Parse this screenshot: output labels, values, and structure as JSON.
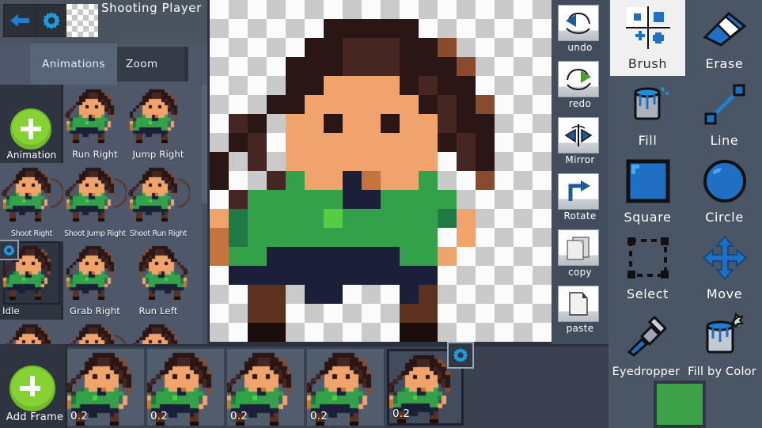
{
  "app": {
    "project_title": "Shooting Player",
    "accent_green": "#86d234",
    "selected_color": "#3da14a",
    "panel_bg": "#4a5565",
    "left_panel_bg": "#4e586a",
    "timeline_bg": "#3a4150"
  },
  "header": {
    "back_icon": "back-arrow-icon",
    "settings_icon": "gear-icon",
    "transparency_swatch": "transparency-checker-swatch"
  },
  "tabs": [
    {
      "id": "animations",
      "label": "Animations",
      "active": true
    },
    {
      "id": "zoom",
      "label": "Zoom",
      "active": false
    }
  ],
  "animations_panel": {
    "add_button_label": "Animation",
    "add_button_icon": "plus-icon",
    "selected_gear_icon": "gear-icon",
    "items": [
      {
        "label": "Run Right",
        "selected": false
      },
      {
        "label": "Jump Right",
        "selected": false
      },
      {
        "label": "Shoot Right",
        "selected": false
      },
      {
        "label": "Shoot Jump Right",
        "selected": false
      },
      {
        "label": "Shoot Run Right",
        "selected": false
      },
      {
        "label": "Idle",
        "selected": true
      },
      {
        "label": "Grab Right",
        "selected": false
      },
      {
        "label": "Run Left",
        "selected": false
      }
    ]
  },
  "edit_tools": [
    {
      "id": "undo",
      "label": "undo",
      "icon": "undo-arrow-icon"
    },
    {
      "id": "redo",
      "label": "redo",
      "icon": "redo-arrow-icon"
    },
    {
      "id": "mirror",
      "label": "Mirror",
      "icon": "mirror-icon"
    },
    {
      "id": "rotate",
      "label": "Rotate",
      "icon": "rotate-arrow-icon"
    },
    {
      "id": "copy",
      "label": "copy",
      "icon": "copy-pages-icon"
    },
    {
      "id": "paste",
      "label": "paste",
      "icon": "paste-page-icon"
    }
  ],
  "paint_tools": [
    {
      "id": "brush",
      "label": "Brush",
      "icon": "brush-quad-icon",
      "selected": true
    },
    {
      "id": "erase",
      "label": "Erase",
      "icon": "eraser-icon",
      "selected": false
    },
    {
      "id": "fill",
      "label": "Fill",
      "icon": "paint-bucket-icon",
      "selected": false
    },
    {
      "id": "line",
      "label": "Line",
      "icon": "line-icon",
      "selected": false
    },
    {
      "id": "square",
      "label": "Square",
      "icon": "square-icon",
      "selected": false
    },
    {
      "id": "circle",
      "label": "Circle",
      "icon": "circle-icon",
      "selected": false
    },
    {
      "id": "select",
      "label": "Select",
      "icon": "dashed-select-icon",
      "selected": false
    },
    {
      "id": "move",
      "label": "Move",
      "icon": "move-arrows-icon",
      "selected": false
    },
    {
      "id": "eyedropper",
      "label": "Eyedropper",
      "icon": "eyedropper-icon",
      "selected": false
    },
    {
      "id": "fill-by-color",
      "label": "Fill by Color",
      "icon": "paint-bucket-star-icon",
      "selected": false
    }
  ],
  "timeline": {
    "add_frame_label": "Add Frame",
    "add_frame_icon": "plus-icon",
    "frame_gear_icon": "gear-icon",
    "frames": [
      {
        "index": 1,
        "duration": "0.2",
        "selected": false
      },
      {
        "index": 2,
        "duration": "0.2",
        "selected": false
      },
      {
        "index": 3,
        "duration": "0.2",
        "selected": false
      },
      {
        "index": 4,
        "duration": "0.2",
        "selected": false
      },
      {
        "index": 5,
        "duration": "0.2",
        "selected": true
      }
    ]
  },
  "canvas": {
    "background": "transparency-checkerboard",
    "sprite_name": "idle-player-sprite"
  }
}
